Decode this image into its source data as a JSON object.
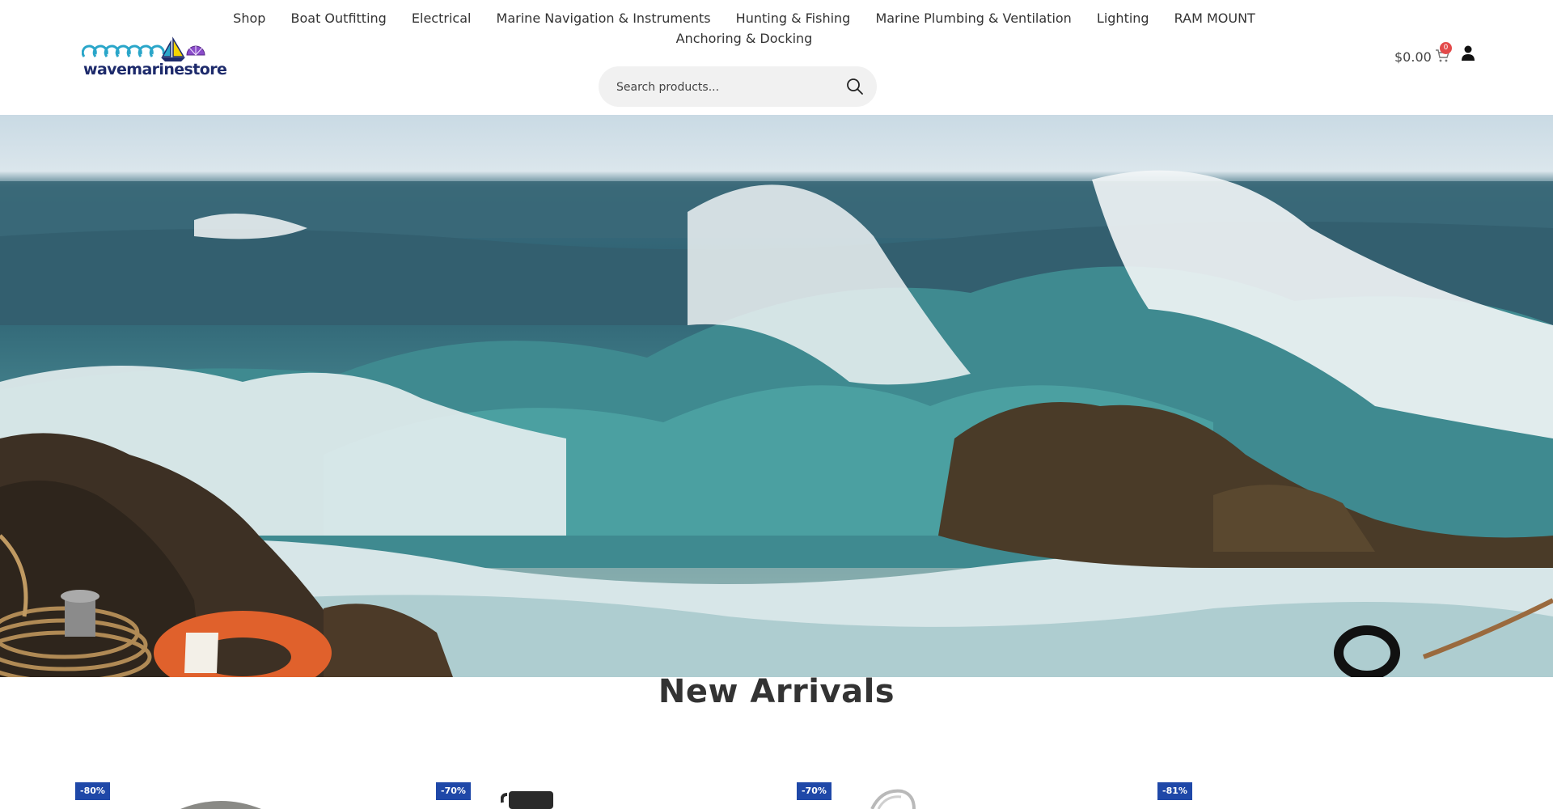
{
  "brand": {
    "name": "wavemarinestore"
  },
  "nav": {
    "row1": [
      "Shop",
      "Boat Outfitting",
      "Electrical",
      "Marine Navigation & Instruments",
      "Hunting & Fishing",
      "Marine Plumbing & Ventilation",
      "Lighting",
      "RAM MOUNT"
    ],
    "row2": [
      "Anchoring & Docking"
    ]
  },
  "search": {
    "placeholder": "Search products..."
  },
  "cart": {
    "total": "$0.00",
    "count": "0"
  },
  "section": {
    "title": "New Arrivals"
  },
  "products": [
    {
      "discount": "-80%"
    },
    {
      "discount": "-70%"
    },
    {
      "discount": "-70%"
    },
    {
      "discount": "-81%"
    }
  ],
  "colors": {
    "badge": "#1f48a8",
    "cart_badge": "#e34a4a",
    "brand_navy": "#1d2a6b",
    "brand_teal": "#2aa6c9"
  },
  "icons": [
    "search-icon",
    "cart-icon",
    "user-icon"
  ]
}
